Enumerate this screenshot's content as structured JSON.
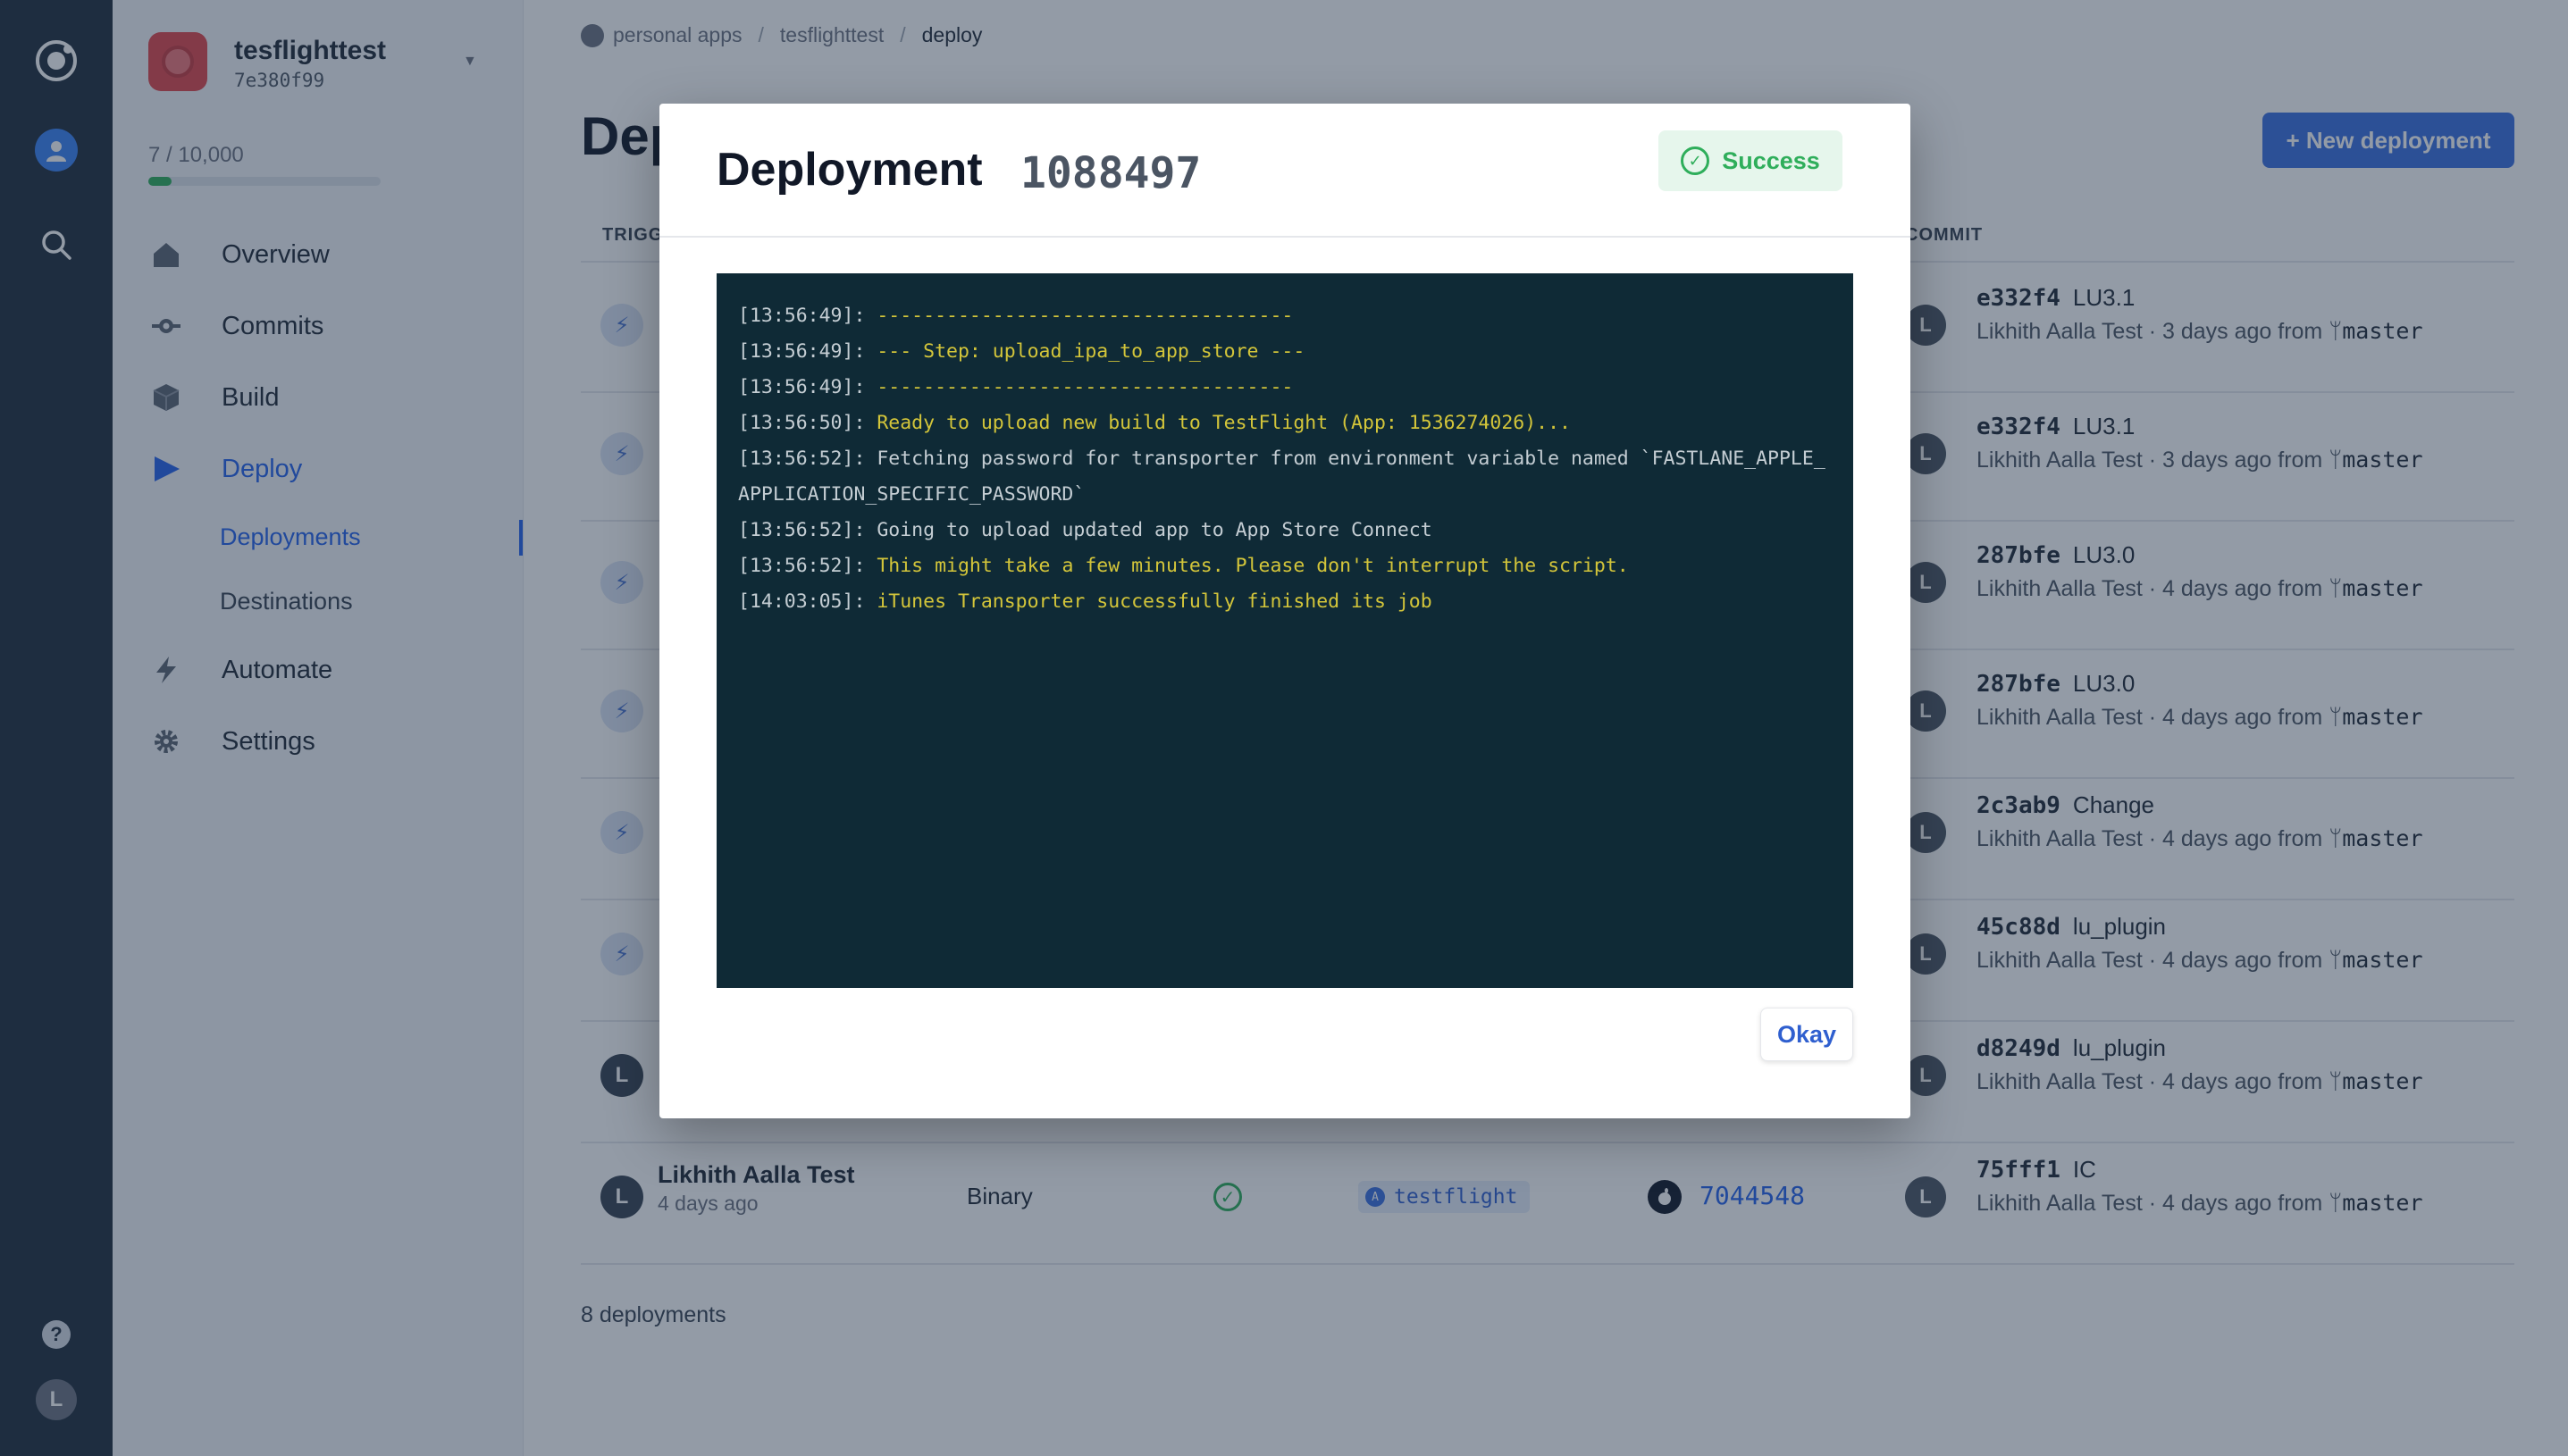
{
  "breadcrumb": {
    "account": "personal apps",
    "app": "tesflighttest",
    "current": "deploy"
  },
  "app": {
    "name": "tesflighttest",
    "id": "7e380f99",
    "usage_label": "7 / 10,000",
    "usage_fraction": 0.0007
  },
  "nav": {
    "overview": "Overview",
    "commits": "Commits",
    "build": "Build",
    "deploy": "Deploy",
    "deployments": "Deployments",
    "destinations": "Destinations",
    "automate": "Automate",
    "settings": "Settings"
  },
  "rail": {
    "help": "?",
    "user_initial": "L"
  },
  "page": {
    "title": "Deployments",
    "new_button": "+ New deployment",
    "footer_count": "8 deployments"
  },
  "table": {
    "header_trigger": "TRIGGER",
    "header_commit": "COMMIT",
    "rows": [
      {
        "sha": "e332f4",
        "msg": "LU3.1",
        "author": "Likhith Aalla Test",
        "when": "3 days ago from",
        "branch": "master"
      },
      {
        "sha": "e332f4",
        "msg": "LU3.1",
        "author": "Likhith Aalla Test",
        "when": "3 days ago from",
        "branch": "master"
      },
      {
        "sha": "287bfe",
        "msg": "LU3.0",
        "author": "Likhith Aalla Test",
        "when": "4 days ago from",
        "branch": "master"
      },
      {
        "sha": "287bfe",
        "msg": "LU3.0",
        "author": "Likhith Aalla Test",
        "when": "4 days ago from",
        "branch": "master"
      },
      {
        "sha": "2c3ab9",
        "msg": "Change",
        "author": "Likhith Aalla Test",
        "when": "4 days ago from",
        "branch": "master"
      },
      {
        "sha": "45c88d",
        "msg": "lu_plugin",
        "author": "Likhith Aalla Test",
        "when": "4 days ago from",
        "branch": "master"
      },
      {
        "sha": "d8249d",
        "msg": "lu_plugin",
        "author": "Likhith Aalla Test",
        "when": "4 days ago from",
        "branch": "master"
      },
      {
        "sha": "75fff1",
        "msg": "IC",
        "author": "Likhith Aalla Test",
        "when": "4 days ago from",
        "branch": "master",
        "trigger_name": "Likhith Aalla Test",
        "trigger_time": "4 days ago",
        "type": "Binary",
        "destination": "testflight",
        "build": "7044548"
      }
    ]
  },
  "modal": {
    "title": "Deployment",
    "id": "1088497",
    "status": "Success",
    "okay_label": "Okay",
    "log": [
      {
        "ts": "[13:56:49]:",
        "msg": "------------------------------------",
        "color": "yellow"
      },
      {
        "ts": "[13:56:49]:",
        "msg": "--- Step: upload_ipa_to_app_store ---",
        "color": "yellow"
      },
      {
        "ts": "[13:56:49]:",
        "msg": "------------------------------------",
        "color": "yellow"
      },
      {
        "ts": "[13:56:50]:",
        "msg": "Ready to upload new build to TestFlight (App: 1536274026)...",
        "color": "yellow"
      },
      {
        "ts": "[13:56:52]:",
        "msg": "Fetching password for transporter from environment variable named `FASTLANE_APPLE_APPLICATION_SPECIFIC_PASSWORD`",
        "color": "white"
      },
      {
        "ts": "[13:56:52]:",
        "msg": "Going to upload updated app to App Store Connect",
        "color": "white"
      },
      {
        "ts": "[13:56:52]:",
        "msg": "This might take a few minutes. Please don't interrupt the script.",
        "color": "yellow"
      },
      {
        "ts": "[14:03:05]:",
        "msg": "iTunes Transporter successfully finished its job",
        "color": "yellow"
      }
    ]
  },
  "colors": {
    "accent": "#2563eb",
    "success": "#2fae5b",
    "console_bg": "#0f2a36",
    "log_yellow": "#d3c53a"
  }
}
